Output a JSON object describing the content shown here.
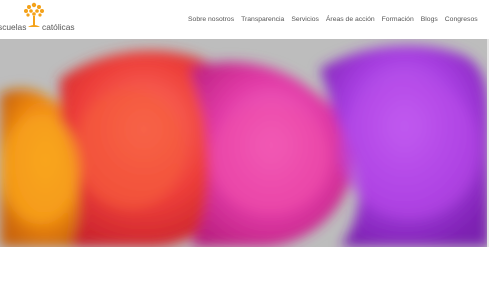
{
  "logo": {
    "word1": "scuelas",
    "word2": "católicas",
    "icon": "tree-icon"
  },
  "nav": {
    "items": [
      {
        "label": "Sobre nosotros"
      },
      {
        "label": "Transparencia"
      },
      {
        "label": "Servicios"
      },
      {
        "label": "Áreas de acción"
      },
      {
        "label": "Formación"
      },
      {
        "label": "Blogs"
      },
      {
        "label": "Congresos"
      }
    ]
  },
  "hero": {
    "colors": {
      "orange": "#f08a12",
      "red": "#ee3f3a",
      "pink": "#e13aa6",
      "purple": "#a63de0",
      "background": "#bdbdbd"
    },
    "slides_count": 5,
    "active_slide": 1
  },
  "brand": {
    "logo_color": "#f4a21a"
  }
}
